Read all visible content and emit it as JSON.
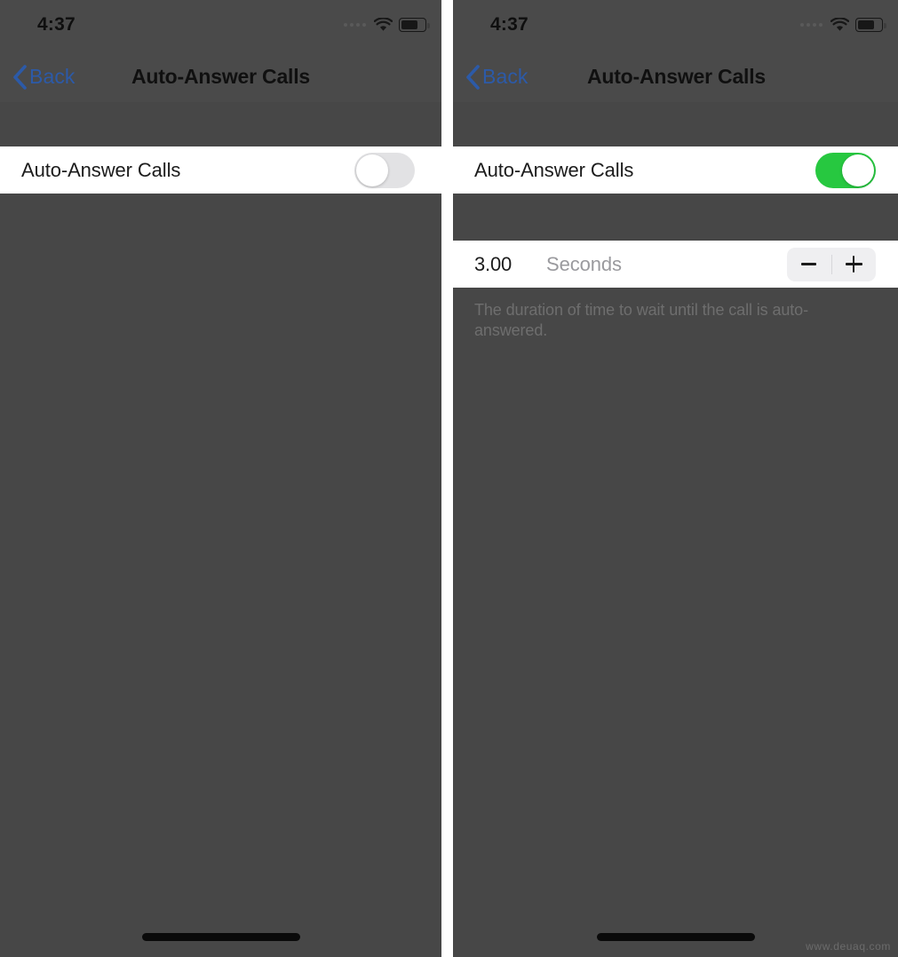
{
  "watermark": "www.deuaq.com",
  "screens": [
    {
      "id": "auto-answer-off",
      "status_bar": {
        "time": "4:37",
        "signal_icon": "signal-dots-icon",
        "wifi_icon": "wifi-icon",
        "battery_icon": "battery-icon"
      },
      "nav_bar": {
        "back_label": "Back",
        "back_icon": "chevron-left-icon",
        "title": "Auto-Answer Calls"
      },
      "rows": {
        "toggle_row": {
          "label": "Auto-Answer Calls",
          "toggle_state": "off",
          "toggle_name": "auto-answer-calls-toggle"
        }
      },
      "home_indicator": true
    },
    {
      "id": "auto-answer-on",
      "status_bar": {
        "time": "4:37",
        "signal_icon": "signal-dots-icon",
        "wifi_icon": "wifi-icon",
        "battery_icon": "battery-icon"
      },
      "nav_bar": {
        "back_label": "Back",
        "back_icon": "chevron-left-icon",
        "title": "Auto-Answer Calls"
      },
      "rows": {
        "toggle_row": {
          "label": "Auto-Answer Calls",
          "toggle_state": "on",
          "toggle_name": "auto-answer-calls-toggle"
        },
        "stepper_row": {
          "value": "3.00",
          "unit": "Seconds",
          "decrement_label": "−",
          "increment_label": "+"
        }
      },
      "footnote": "The duration of time to wait until the call is auto-answered.",
      "home_indicator": true
    }
  ],
  "colors": {
    "toggle_on": "#27c840",
    "toggle_off": "#e2e2e4",
    "back_link": "#2c5aa8",
    "row_background": "#ffffff",
    "page_background": "#474747",
    "footnote_text": "#6e6e6e",
    "unit_text": "#9a9a9e"
  }
}
